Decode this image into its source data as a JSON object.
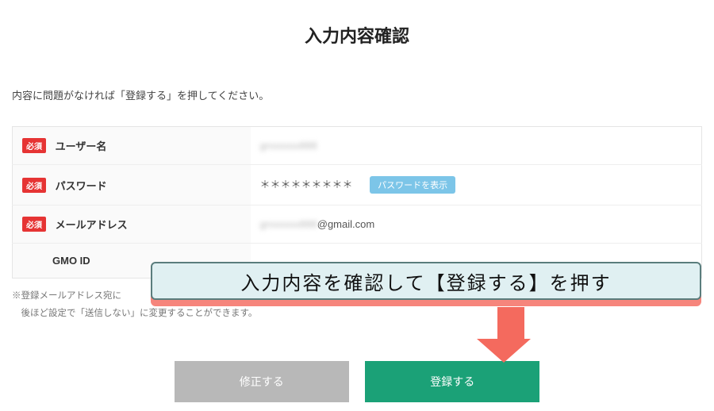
{
  "title": "入力内容確認",
  "instruction": "内容に問題がなければ「登録する」を押してください。",
  "required_label": "必須",
  "fields": {
    "username": {
      "label": "ユーザー名",
      "value": "grxxxxxx888"
    },
    "password": {
      "label": "パスワード",
      "value": "＊＊＊＊＊＊＊＊＊",
      "show_btn": "パスワードを表示"
    },
    "email": {
      "label": "メールアドレス",
      "value_prefix": "grxxxxxx888",
      "value_suffix": "@gmail.com"
    },
    "gmo": {
      "label": "GMO ID"
    }
  },
  "notes": {
    "line1_prefix": "※登録メールアドレス宛に",
    "line2": "　後ほど設定で「送信しない」に変更することができます。"
  },
  "buttons": {
    "edit": "修正する",
    "submit": "登録する"
  },
  "callout": "入力内容を確認して【登録する】を押す"
}
